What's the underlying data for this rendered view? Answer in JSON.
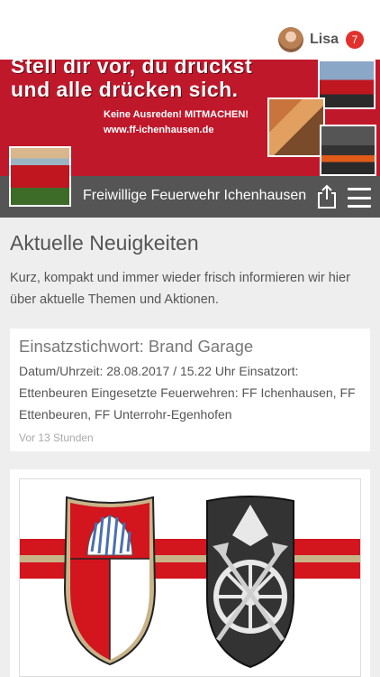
{
  "header": {
    "user_name": "Lisa",
    "notification_count": "7"
  },
  "banner": {
    "line1": "Stell dir vor, du druckst",
    "line2": "und alle drücken sich.",
    "tagline": "Keine Ausreden! MITMACHEN!",
    "url": "www.ff-ichenhausen.de"
  },
  "nav": {
    "title": "Freiwillige Feuerwehr Ichenhausen"
  },
  "page": {
    "title": "Aktuelle Neuigkeiten",
    "description": "Kurz, kompakt und immer wieder frisch informieren wir hier über aktuelle Themen und Aktionen."
  },
  "news": [
    {
      "title": "Einsatzstichwort: Brand Garage",
      "body": "Datum/Uhrzeit: 28.08.2017 / 15.22 Uhr Einsatzort: Ettenbeuren Eingesetzte Feuerwehren: FF Ichenhausen, FF Ettenbeuren, FF Unterrohr-Egenhofen",
      "time": "Vor 13 Stunden"
    }
  ],
  "colors": {
    "brand_red": "#c0182b",
    "nav_gray": "#555555",
    "badge_red": "#e2302c",
    "page_bg": "#eeeeee"
  },
  "icons": [
    "avatar",
    "share-icon",
    "hamburger-menu-icon",
    "coat-of-arms",
    "fire-brigade-emblem"
  ]
}
